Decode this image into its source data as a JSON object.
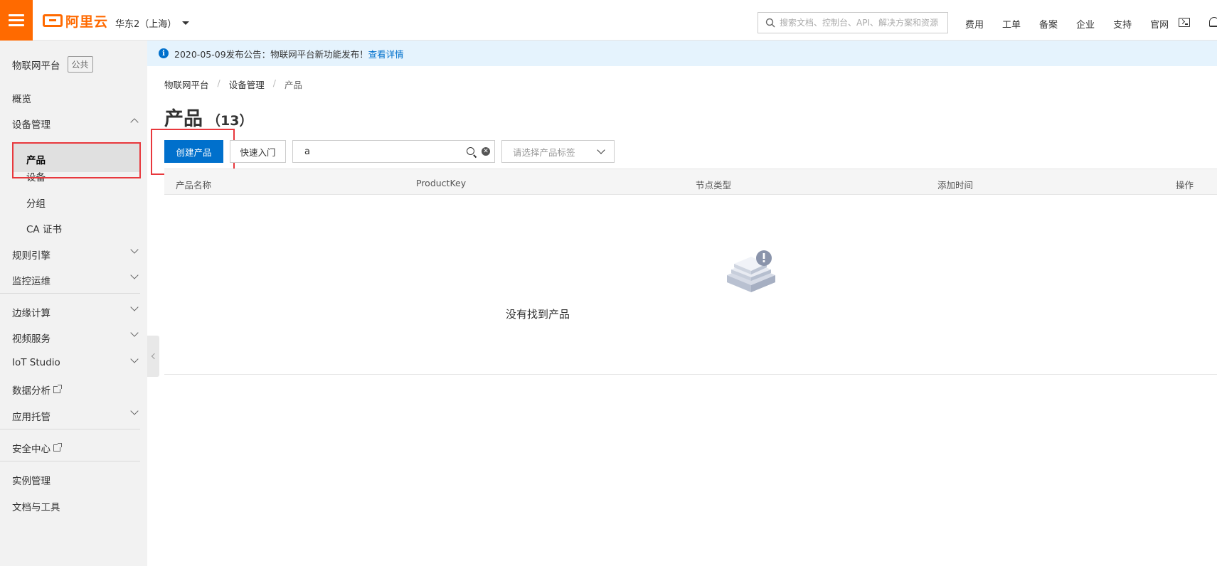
{
  "topbar": {
    "logo_text": "阿里云",
    "region": "华东2（上海）",
    "search_placeholder": "搜索文档、控制台、API、解决方案和资源",
    "links": [
      "费用",
      "工单",
      "备案",
      "企业",
      "支持",
      "官网"
    ]
  },
  "sidebar": {
    "title": "物联网平台",
    "badge": "公共",
    "items": {
      "overview": "概览",
      "device_mgmt": "设备管理",
      "product": "产品",
      "device": "设备",
      "group": "分组",
      "ca": "CA 证书",
      "rules": "规则引擎",
      "monitor": "监控运维",
      "edge": "边缘计算",
      "video": "视频服务",
      "iot_studio": "IoT Studio",
      "data_analysis": "数据分析",
      "app_hosting": "应用托管",
      "security": "安全中心",
      "instance": "实例管理",
      "docs_tools": "文档与工具"
    }
  },
  "notice": {
    "text": "2020-05-09发布公告：物联网平台新功能发布！",
    "link": "查看详情"
  },
  "breadcrumb": [
    "物联网平台",
    "设备管理",
    "产品"
  ],
  "breadcrumb_sep": "/",
  "page": {
    "title": "产品",
    "count": "（13）"
  },
  "toolbar": {
    "create_label": "创建产品",
    "quickstart_label": "快速入门",
    "search_value": "a",
    "tag_placeholder": "请选择产品标签"
  },
  "table": {
    "columns": [
      "产品名称",
      "ProductKey",
      "节点类型",
      "添加时间",
      "操作"
    ]
  },
  "empty_text": "没有找到产品",
  "colors": {
    "accent_orange": "#ff6a00",
    "primary_blue": "#0070cc",
    "highlight_red": "#e8383d"
  }
}
